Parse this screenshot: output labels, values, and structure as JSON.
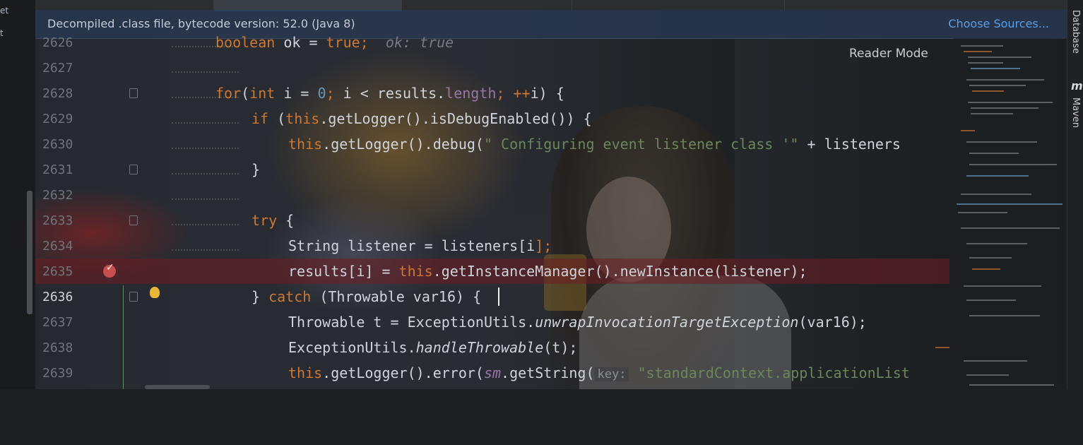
{
  "banner": {
    "message": "Decompiled .class file, bytecode version: 52.0 (Java 8)",
    "choose_sources": "Choose Sources..."
  },
  "editor": {
    "reader_mode": "Reader Mode",
    "current_line": "2636",
    "line_numbers": [
      "2626",
      "2627",
      "2628",
      "2629",
      "2630",
      "2631",
      "2632",
      "2633",
      "2634",
      "2635",
      "2636",
      "2637",
      "2638",
      "2639"
    ]
  },
  "right_sidebar": {
    "database": "Database",
    "maven_icon": "m",
    "maven": "Maven"
  },
  "left_sidebar": {
    "labels": [
      "et",
      "t"
    ]
  },
  "code": {
    "l2626": {
      "kw": "boolean ",
      "id": "ok",
      "op": " = ",
      "val": "true;",
      "hint": "ok: true"
    },
    "l2628": {
      "kw": "for",
      "a": "(",
      "kw2": "int ",
      "v": "i",
      "b": " = ",
      "n": "0",
      "c": "; ",
      "v2": "i",
      "d": " < results.",
      "f": "length",
      "e": "; ++",
      "v3": "i",
      "g": ") {"
    },
    "l2629": {
      "kw": "if ",
      "a": "(",
      "kw2": "this",
      "b": ".getLogger().isDebugEnabled()) {"
    },
    "l2630": {
      "kw": "this",
      "a": ".getLogger().debug(",
      "s": "\" Configuring event listener class '\"",
      "b": " + listeners"
    },
    "l2631": {
      "a": "}"
    },
    "l2633": {
      "kw": "try ",
      "a": "{"
    },
    "l2634": {
      "a": "String listener = listeners[",
      "v": "i",
      "b": "];"
    },
    "l2635": {
      "a": "results[",
      "v": "i",
      "b": "] = ",
      "kw": "this",
      "c": ".getInstanceManager().newInstance(listener);"
    },
    "l2636": {
      "a": "} ",
      "kw": "catch ",
      "b": "(Throwable var16) {"
    },
    "l2637": {
      "a": "Throwable t = ExceptionUtils.",
      "m": "unwrapInvocationTargetException",
      "b": "(var16);"
    },
    "l2638": {
      "a": "ExceptionUtils.",
      "m": "handleThrowable",
      "b": "(t);"
    },
    "l2639": {
      "kw": "this",
      "a": ".getLogger().error(",
      "f": "sm",
      "b": ".getString(",
      "key": "key:",
      "s": " \"standardContext.applicationList"
    }
  }
}
